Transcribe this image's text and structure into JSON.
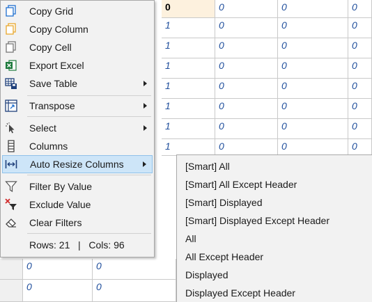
{
  "grid": {
    "row0": [
      "0",
      "0",
      "0",
      "0"
    ],
    "rows_right": [
      [
        "1",
        "0",
        "0",
        "0"
      ],
      [
        "1",
        "0",
        "0",
        "0"
      ],
      [
        "1",
        "0",
        "0",
        "0"
      ],
      [
        "1",
        "0",
        "0",
        "0"
      ],
      [
        "1",
        "0",
        "0",
        "0"
      ],
      [
        "1",
        "0",
        "0",
        "0"
      ],
      [
        "1",
        "0",
        "0",
        "0"
      ]
    ],
    "rows_bottom": [
      [
        "0",
        "0"
      ],
      [
        "0",
        "0"
      ]
    ]
  },
  "menu": {
    "items": [
      {
        "label": "Copy Grid",
        "icon": "copy-grid-icon"
      },
      {
        "label": "Copy Column",
        "icon": "copy-column-icon"
      },
      {
        "label": "Copy Cell",
        "icon": "copy-cell-icon"
      },
      {
        "label": "Export Excel",
        "icon": "excel-icon"
      },
      {
        "label": "Save Table",
        "icon": "save-table-icon"
      },
      {
        "label": "Transpose",
        "icon": "transpose-icon"
      },
      {
        "label": "Select",
        "icon": "cursor-icon"
      },
      {
        "label": "Columns",
        "icon": "columns-icon"
      },
      {
        "label": "Auto Resize Columns",
        "icon": "resize-columns-icon"
      },
      {
        "label": "Filter By Value",
        "icon": "filter-icon"
      },
      {
        "label": "Exclude Value",
        "icon": "exclude-filter-icon"
      },
      {
        "label": "Clear Filters",
        "icon": "eraser-icon"
      }
    ],
    "status": "Rows: 21   |   Cols: 96"
  },
  "submenu": {
    "items": [
      "[Smart] All",
      "[Smart] All Except Header",
      "[Smart] Displayed",
      "[Smart] Displayed Except Header",
      "All",
      "All Except Header",
      "Displayed",
      "Displayed Except Header"
    ]
  },
  "colors": {
    "highlight": "#cde5f8",
    "cell_text": "#1f4e9c",
    "selected_cell": "#fdf1de"
  }
}
